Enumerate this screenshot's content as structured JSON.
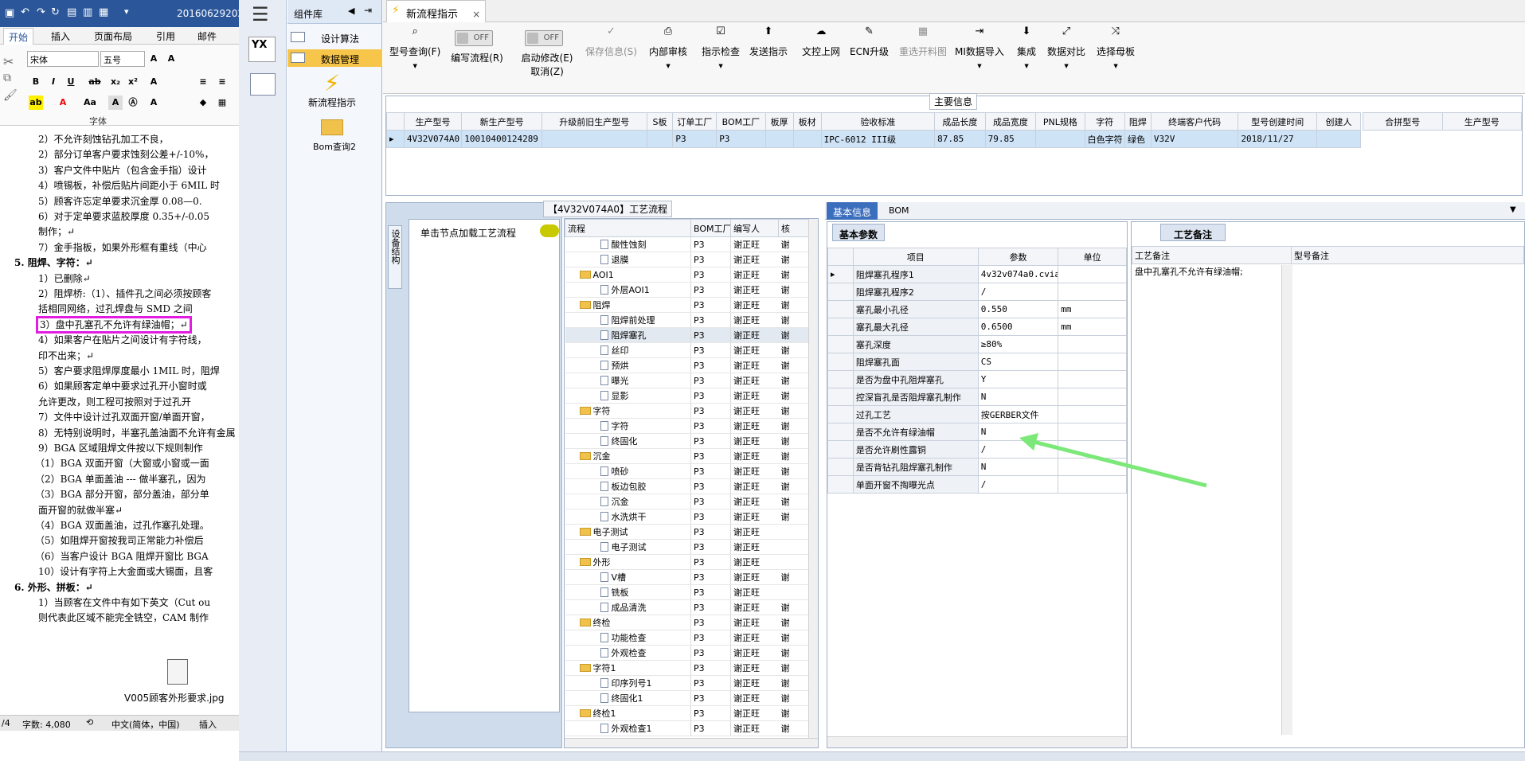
{
  "word": {
    "title": "20160629202",
    "tabs": [
      "开始",
      "插入",
      "页面布局",
      "引用",
      "邮件"
    ],
    "font_name": "宋体",
    "font_size": "五号",
    "font_group_label": "字体",
    "lines": [
      "2）不允许刻蚀钻孔加工不良，",
      "2）部分订单客户要求蚀刻公差+/-10%，",
      "3）客户文件中贴片（包含金手指）设计",
      "4）喷锡板，补偿后贴片间距小于 6MIL 时",
      "5）顾客许忘定单要求沉金厚 0.08—0.",
      "6）对于定单要求蓝胶厚度 0.35+/-0.05",
      "制作；↵",
      "7）金手指板，如果外形框有重线（中心",
      "5.  阻焊、字符：↵",
      "1）已删除↵",
      "2）阻焊桥:（1）、插件孔之间必须按顾客",
      "括相同网络，过孔焊盘与 SMD 之间",
      "3）盘中孔塞孔不允许有绿油帽；↵",
      "4）如果客户在贴片之间设计有字符线，",
      "印不出来；↵",
      "5）客户要求阻焊厚度最小 1MIL 时，阻焊",
      "6）如果顾客定单中要求过孔开小窗时或",
      "允许更改，则工程可按照对于过孔开",
      "7）文件中设计过孔双面开窗/单面开窗，",
      "8）无特别说明时，半塞孔盖油面不允许有金属",
      "9）BGA 区域阻焊文件按以下规则制作",
      "（1）BGA 双面开窗（大窗或小窗或一面",
      "（2）BGA 单面盖油 --- 做半塞孔，因为",
      "（3）BGA 部分开窗，部分盖油，部分单",
      "面开窗的就做半塞↵",
      "（4）BGA 双面盖油，过孔作塞孔处理。",
      "（5）如阻焊开窗按我司正常能力补偿后",
      "（6）当客户设计 BGA 阻焊开窗比 BGA",
      "10）设计有字符上大金面或大锡面，且客",
      "6.  外形、拼板：↵",
      "1）当顾客在文件中有如下英文（Cut ou",
      "则代表此区域不能完全铣空，CAM 制作"
    ],
    "embedded_file": "V005顾客外形要求.jpg",
    "status": {
      "page": "/4",
      "words": "字数: 4,080",
      "lang": "中文(简体，中国)",
      "mode": "插入"
    }
  },
  "left_nav": {
    "logo": "YX"
  },
  "palette": {
    "header": "组件库",
    "items": [
      "设计算法",
      "数据管理"
    ],
    "tools": [
      "新流程指示",
      "Bom查询2"
    ]
  },
  "doc_tab": "新流程指示",
  "toolbar": [
    {
      "label": "型号查询(F)",
      "icon": "search-icon"
    },
    {
      "label": "编写流程(R)",
      "toggle": "OFF"
    },
    {
      "label": "启动修改(E)",
      "toggle": "OFF",
      "sub": "取消(Z)"
    },
    {
      "label": "保存信息(S)",
      "disabled": true
    },
    {
      "label": "内部审核"
    },
    {
      "label": "指示检查"
    },
    {
      "label": "发送指示"
    },
    {
      "label": "文控上网"
    },
    {
      "label": "ECN升级"
    },
    {
      "label": "重选开料图",
      "disabled": true
    },
    {
      "label": "MI数据导入"
    },
    {
      "label": "集成"
    },
    {
      "label": "数据对比"
    },
    {
      "label": "选择母板"
    }
  ],
  "main_info": {
    "title": "主要信息",
    "columns": [
      "生产型号",
      "新生产型号",
      "升级前旧生产型号",
      "S板",
      "订单工厂",
      "BOM工厂",
      "板厚",
      "板材",
      "验收标准",
      "成品长度",
      "成品宽度",
      "PNL规格",
      "字符",
      "阻焊",
      "终端客户代码",
      "型号创建时间",
      "创建人"
    ],
    "row": [
      "4V32V074A0",
      "10010400124289",
      "",
      "",
      "P3",
      "P3",
      "",
      "",
      "IPC-6012 III级",
      "87.85",
      "79.85",
      "",
      "白色字符",
      "绿色",
      "V32V",
      "2018/11/27",
      ""
    ],
    "side_columns": [
      "合拼型号",
      "生产型号"
    ]
  },
  "flow": {
    "title": "【4V32V074A0】工艺流程",
    "side_tab": "设备结构",
    "hint": "单击节点加载工艺流程",
    "columns": [
      "流程",
      "BOM工厂",
      "编写人",
      "核"
    ],
    "rows": [
      {
        "name": "酸性蚀刻",
        "lvl": 2,
        "f": "P3",
        "w": "谢正旺",
        "k": "谢"
      },
      {
        "name": "退膜",
        "lvl": 2,
        "f": "P3",
        "w": "谢正旺",
        "k": "谢"
      },
      {
        "name": "AOI1",
        "lvl": 1,
        "f": "P3",
        "w": "谢正旺",
        "k": "谢"
      },
      {
        "name": "外层AOI1",
        "lvl": 2,
        "f": "P3",
        "w": "谢正旺",
        "k": "谢"
      },
      {
        "name": "阻焊",
        "lvl": 1,
        "f": "P3",
        "w": "谢正旺",
        "k": "谢"
      },
      {
        "name": "阻焊前处理",
        "lvl": 2,
        "f": "P3",
        "w": "谢正旺",
        "k": "谢"
      },
      {
        "name": "阻焊塞孔",
        "lvl": 2,
        "f": "P3",
        "w": "谢正旺",
        "k": "谢",
        "sel": true
      },
      {
        "name": "丝印",
        "lvl": 2,
        "f": "P3",
        "w": "谢正旺",
        "k": "谢"
      },
      {
        "name": "预烘",
        "lvl": 2,
        "f": "P3",
        "w": "谢正旺",
        "k": "谢"
      },
      {
        "name": "曝光",
        "lvl": 2,
        "f": "P3",
        "w": "谢正旺",
        "k": "谢"
      },
      {
        "name": "显影",
        "lvl": 2,
        "f": "P3",
        "w": "谢正旺",
        "k": "谢"
      },
      {
        "name": "字符",
        "lvl": 1,
        "f": "P3",
        "w": "谢正旺",
        "k": "谢"
      },
      {
        "name": "字符",
        "lvl": 2,
        "f": "P3",
        "w": "谢正旺",
        "k": "谢"
      },
      {
        "name": "终固化",
        "lvl": 2,
        "f": "P3",
        "w": "谢正旺",
        "k": "谢"
      },
      {
        "name": "沉金",
        "lvl": 1,
        "f": "P3",
        "w": "谢正旺",
        "k": "谢"
      },
      {
        "name": "喷砂",
        "lvl": 2,
        "f": "P3",
        "w": "谢正旺",
        "k": "谢"
      },
      {
        "name": "板边包胶",
        "lvl": 2,
        "f": "P3",
        "w": "谢正旺",
        "k": "谢"
      },
      {
        "name": "沉金",
        "lvl": 2,
        "f": "P3",
        "w": "谢正旺",
        "k": "谢"
      },
      {
        "name": "水洗烘干",
        "lvl": 2,
        "f": "P3",
        "w": "谢正旺",
        "k": "谢"
      },
      {
        "name": "电子测试",
        "lvl": 1,
        "f": "P3",
        "w": "谢正旺",
        "k": ""
      },
      {
        "name": "电子测试",
        "lvl": 2,
        "f": "P3",
        "w": "谢正旺",
        "k": ""
      },
      {
        "name": "外形",
        "lvl": 1,
        "f": "P3",
        "w": "谢正旺",
        "k": ""
      },
      {
        "name": "V槽",
        "lvl": 2,
        "f": "P3",
        "w": "谢正旺",
        "k": "谢"
      },
      {
        "name": "铣板",
        "lvl": 2,
        "f": "P3",
        "w": "谢正旺",
        "k": ""
      },
      {
        "name": "成品清洗",
        "lvl": 2,
        "f": "P3",
        "w": "谢正旺",
        "k": "谢"
      },
      {
        "name": "终检",
        "lvl": 1,
        "f": "P3",
        "w": "谢正旺",
        "k": "谢"
      },
      {
        "name": "功能检查",
        "lvl": 2,
        "f": "P3",
        "w": "谢正旺",
        "k": "谢"
      },
      {
        "name": "外观检查",
        "lvl": 2,
        "f": "P3",
        "w": "谢正旺",
        "k": "谢"
      },
      {
        "name": "字符1",
        "lvl": 1,
        "f": "P3",
        "w": "谢正旺",
        "k": "谢"
      },
      {
        "name": "印序列号1",
        "lvl": 2,
        "f": "P3",
        "w": "谢正旺",
        "k": "谢"
      },
      {
        "name": "终固化1",
        "lvl": 2,
        "f": "P3",
        "w": "谢正旺",
        "k": "谢"
      },
      {
        "name": "终检1",
        "lvl": 1,
        "f": "P3",
        "w": "谢正旺",
        "k": "谢"
      },
      {
        "name": "外观检查1",
        "lvl": 2,
        "f": "P3",
        "w": "谢正旺",
        "k": "谢"
      }
    ]
  },
  "info_tabs": [
    "基本信息",
    "BOM"
  ],
  "params": {
    "tab": "基本参数",
    "columns": [
      "项目",
      "参数",
      "单位"
    ],
    "rows": [
      [
        "阻焊塞孔程序1",
        "4v32v074a0.cvia",
        ""
      ],
      [
        "阻焊塞孔程序2",
        "/",
        ""
      ],
      [
        "塞孔最小孔径",
        "0.550",
        "mm"
      ],
      [
        "塞孔最大孔径",
        "0.6500",
        "mm"
      ],
      [
        "塞孔深度",
        "≥80%",
        ""
      ],
      [
        "阻焊塞孔面",
        "CS",
        ""
      ],
      [
        "是否为盘中孔阻焊塞孔",
        "Y",
        ""
      ],
      [
        "控深盲孔是否阻焊塞孔制作",
        "N",
        ""
      ],
      [
        "过孔工艺",
        "按GERBER文件",
        ""
      ],
      [
        "是否不允许有绿油帽",
        "N",
        ""
      ],
      [
        "是否允许刷性露铜",
        "/",
        ""
      ],
      [
        "是否背钻孔阻焊塞孔制作",
        "N",
        ""
      ],
      [
        "单面开窗不掏曝光点",
        "/",
        ""
      ]
    ]
  },
  "remarks": {
    "tab": "工艺备注",
    "columns": [
      "工艺备注",
      "型号备注"
    ],
    "text": "盘中孔塞孔不允许有绿油帽;"
  },
  "colors": {
    "highlight": "#e21de0",
    "arrow": "#7de87a",
    "selected_row": "#cfe3f7",
    "palette_selected": "#f6c54a"
  }
}
